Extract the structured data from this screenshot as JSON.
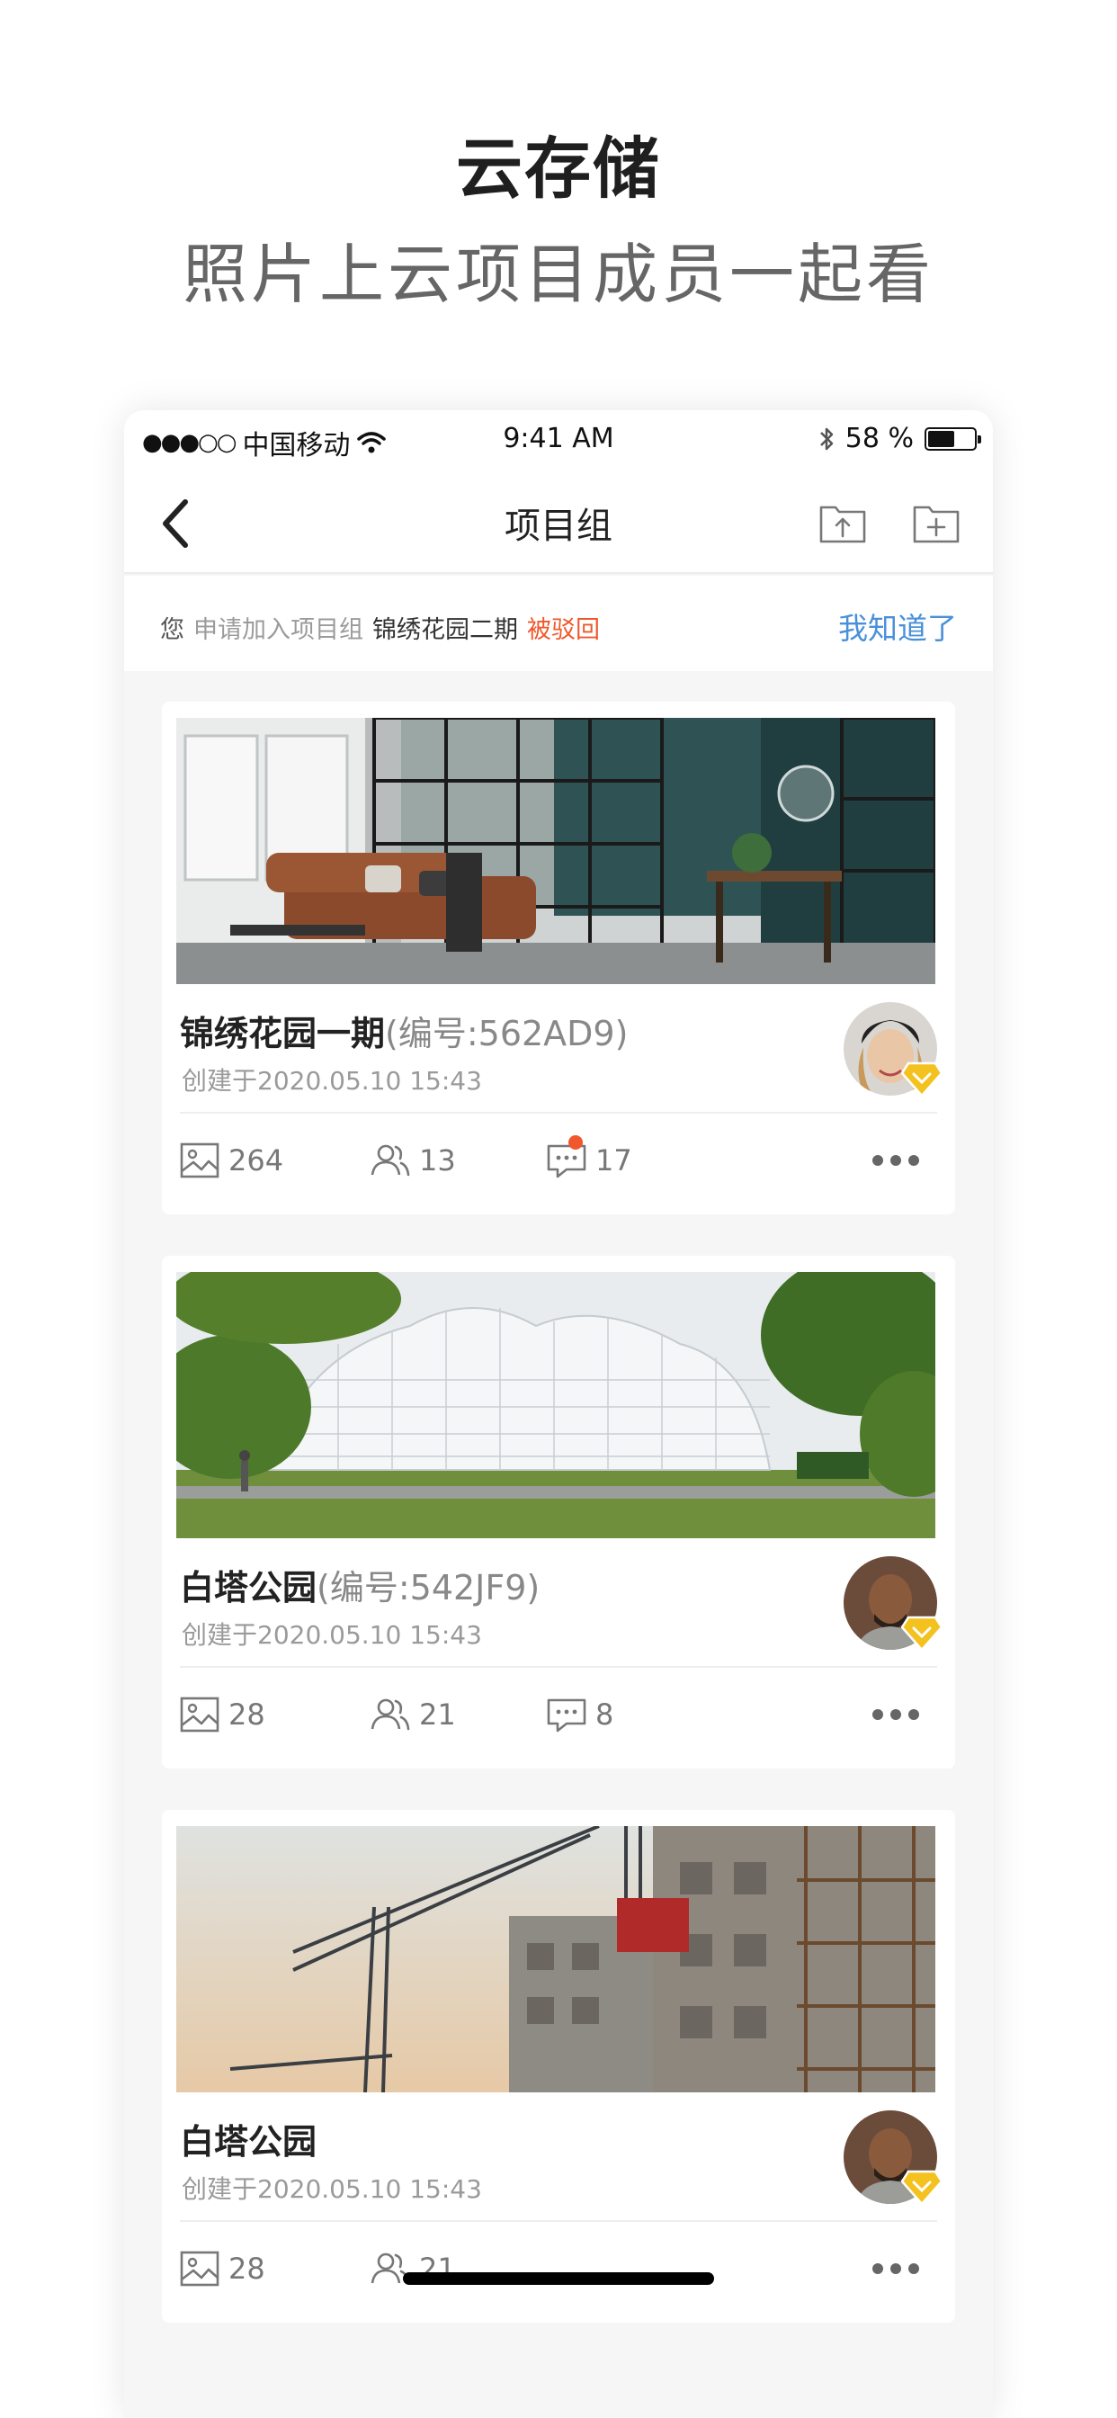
{
  "hero": {
    "title": "云存储",
    "subtitle": "照片上云项目成员一起看"
  },
  "status_bar": {
    "signal": "●●●○○",
    "carrier": "中国移动",
    "time": "9:41 AM",
    "battery_text": "58 %",
    "battery_level": 0.58
  },
  "nav": {
    "back_icon": "chevron-left-icon",
    "title": "项目组",
    "upload_icon": "folder-upload-icon",
    "add_icon": "folder-add-icon"
  },
  "notice": {
    "you": "您",
    "action": "申请加入项目组",
    "project": "锦绣花园二期",
    "status": "被驳回",
    "button": "我知道了"
  },
  "cards": [
    {
      "name": "锦绣花园一期",
      "code": "(编号:562AD9)",
      "created": "创建于2020.05.10   15:43",
      "photos": "264",
      "members": "13",
      "comments": "17",
      "has_unread": true,
      "image": "living-room"
    },
    {
      "name": "白塔公园",
      "code": "(编号:542JF9)",
      "created": "创建于2020.05.10   15:43",
      "photos": "28",
      "members": "21",
      "comments": "8",
      "has_unread": false,
      "image": "pavilion"
    },
    {
      "name": "白塔公园",
      "code": "",
      "created": "创建于2020.05.10   15:43",
      "photos": "28",
      "members": "21",
      "comments": "",
      "has_unread": false,
      "image": "construction"
    }
  ],
  "colors": {
    "accent_blue": "#4a90d9",
    "alert_red": "#f0572b",
    "badge_gold": "#f4c21f"
  }
}
